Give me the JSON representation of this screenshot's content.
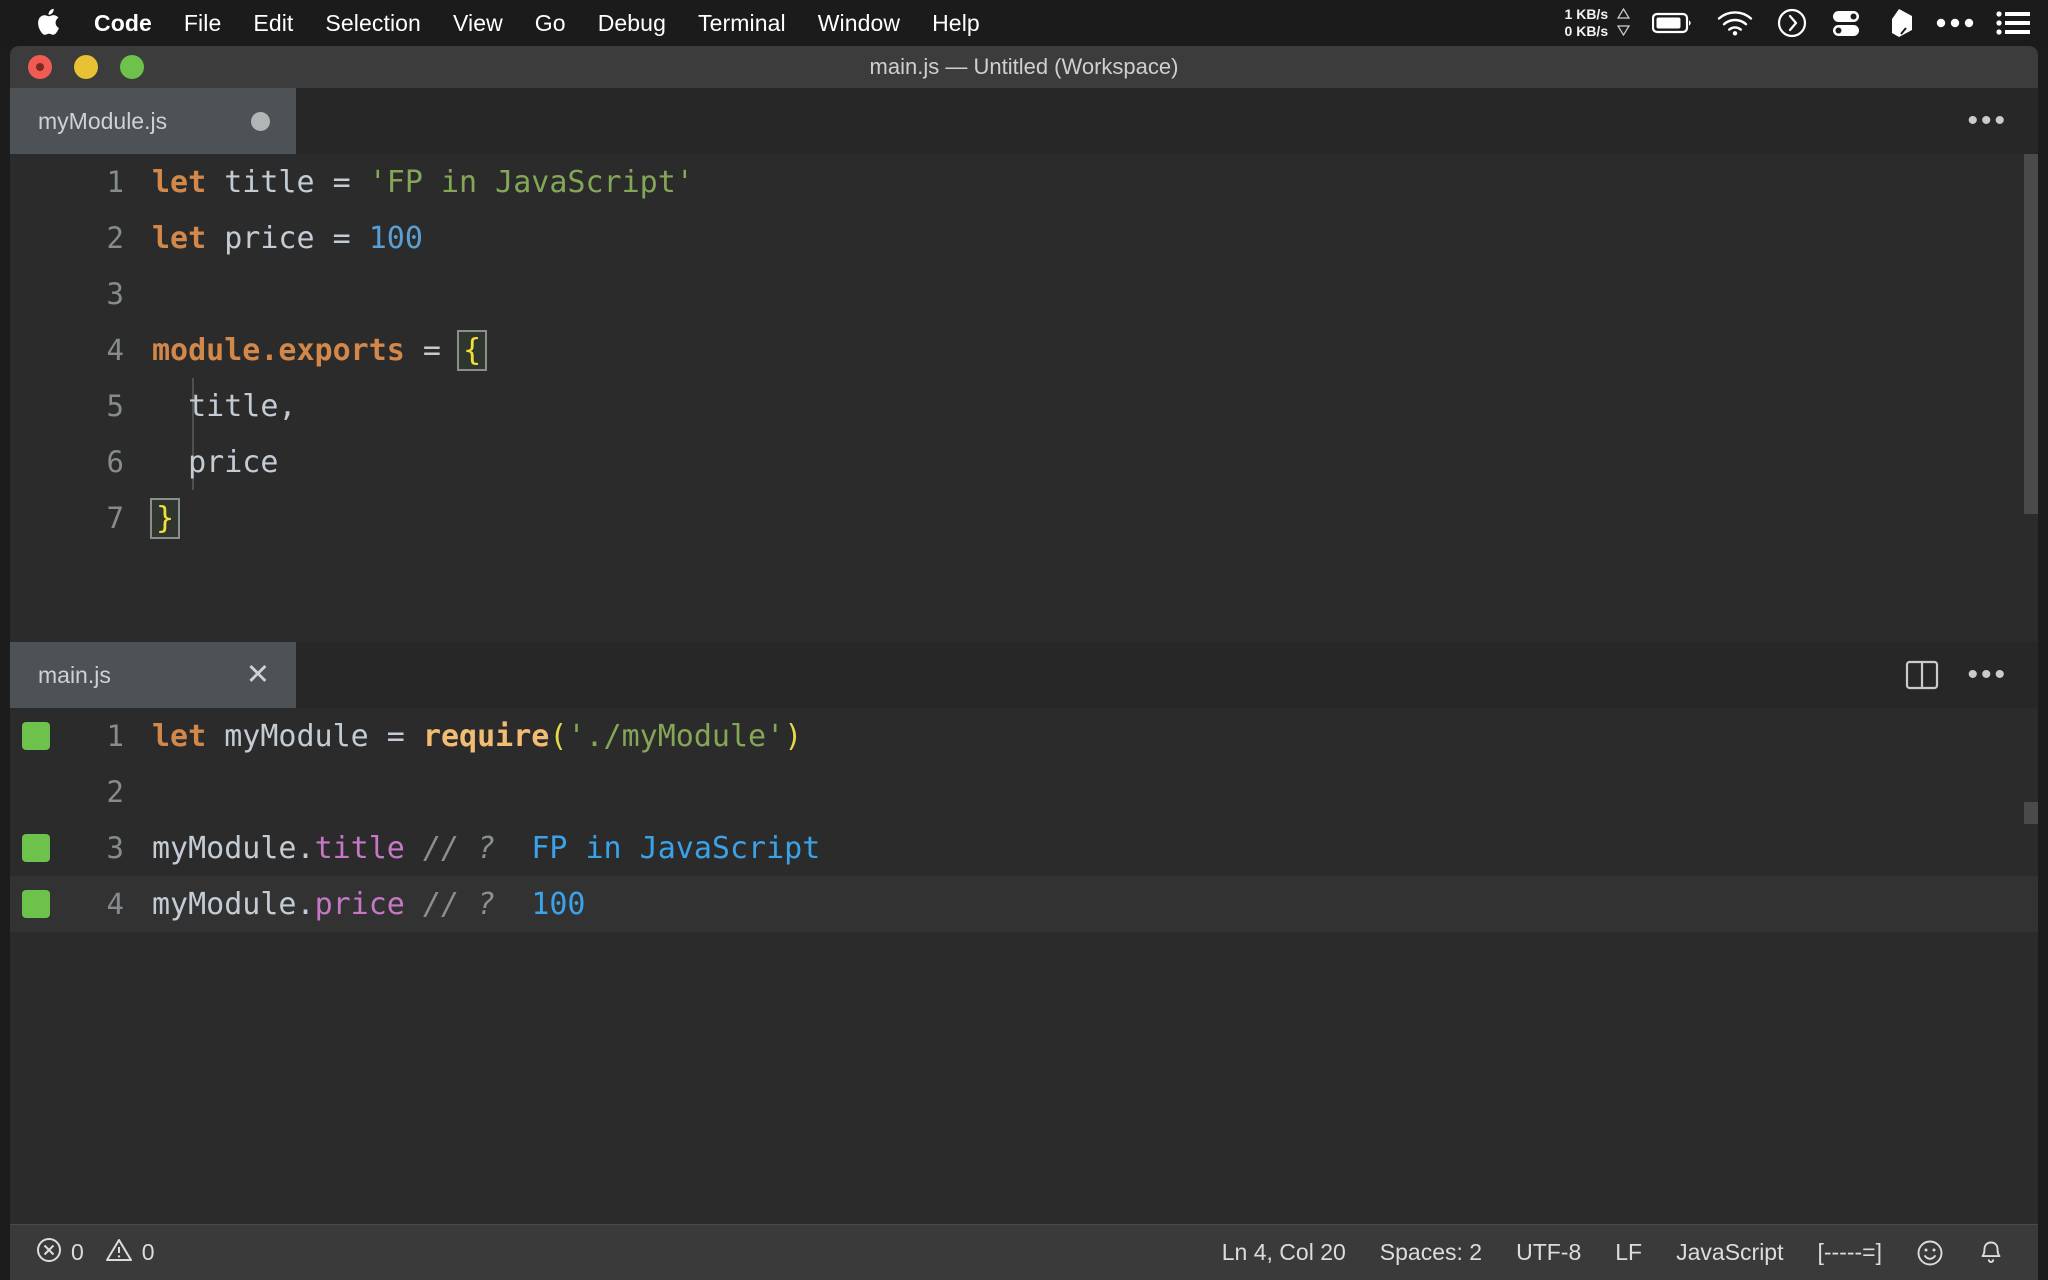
{
  "menubar": {
    "apple_icon": "apple-logo",
    "items": [
      {
        "label": "Code",
        "bold": true
      },
      {
        "label": "File",
        "bold": false
      },
      {
        "label": "Edit",
        "bold": false
      },
      {
        "label": "Selection",
        "bold": false
      },
      {
        "label": "View",
        "bold": false
      },
      {
        "label": "Go",
        "bold": false
      },
      {
        "label": "Debug",
        "bold": false
      },
      {
        "label": "Terminal",
        "bold": false
      },
      {
        "label": "Window",
        "bold": false
      },
      {
        "label": "Help",
        "bold": false
      }
    ],
    "network": {
      "upload": "1 KB/s",
      "download": "0 KB/s"
    },
    "status_icons": [
      "battery-icon",
      "wifi-icon",
      "clock-icon",
      "sliders-icon",
      "dropbox-icon",
      "ellipsis-icon",
      "list-icon"
    ]
  },
  "window": {
    "title": "main.js — Untitled (Workspace)",
    "traffic_lights": [
      "close-button",
      "minimize-button",
      "maximize-button"
    ]
  },
  "editor_top": {
    "tab": {
      "label": "myModule.js",
      "dirty": true,
      "dirty_indicator": "unsaved-dot"
    },
    "actions": [
      "more-actions-icon"
    ],
    "lines": [
      {
        "number": "1",
        "tokens": [
          {
            "text": "let",
            "cls": "t-kw"
          },
          {
            "text": " ",
            "cls": "t-op"
          },
          {
            "text": "title",
            "cls": "t-var"
          },
          {
            "text": " = ",
            "cls": "t-op"
          },
          {
            "text": "'FP in JavaScript'",
            "cls": "t-str"
          }
        ]
      },
      {
        "number": "2",
        "tokens": [
          {
            "text": "let",
            "cls": "t-kw"
          },
          {
            "text": " ",
            "cls": "t-op"
          },
          {
            "text": "price",
            "cls": "t-var"
          },
          {
            "text": " = ",
            "cls": "t-op"
          },
          {
            "text": "100",
            "cls": "t-num"
          }
        ]
      },
      {
        "number": "3",
        "tokens": []
      },
      {
        "number": "4",
        "tokens": [
          {
            "text": "module.exports",
            "cls": "t-mod"
          },
          {
            "text": " = ",
            "cls": "t-op"
          },
          {
            "text": "{",
            "cls": "t-brace"
          }
        ]
      },
      {
        "number": "5",
        "tokens": [
          {
            "text": "  title,",
            "cls": "t-var"
          }
        ]
      },
      {
        "number": "6",
        "tokens": [
          {
            "text": "  price",
            "cls": "t-var"
          }
        ]
      },
      {
        "number": "7",
        "tokens": [
          {
            "text": "}",
            "cls": "t-brace"
          }
        ]
      }
    ]
  },
  "editor_bottom": {
    "tab": {
      "label": "main.js",
      "close_label": "✕"
    },
    "actions": [
      "split-editor-icon",
      "more-actions-icon"
    ],
    "lines": [
      {
        "number": "1",
        "marker": true,
        "current": false,
        "tokens": [
          {
            "text": "let",
            "cls": "t-kw"
          },
          {
            "text": " ",
            "cls": "t-op"
          },
          {
            "text": "myModule",
            "cls": "t-var"
          },
          {
            "text": " = ",
            "cls": "t-op"
          },
          {
            "text": "require",
            "cls": "t-fn"
          },
          {
            "text": "(",
            "cls": "t-paren"
          },
          {
            "text": "'./myModule'",
            "cls": "t-str"
          },
          {
            "text": ")",
            "cls": "t-paren"
          }
        ]
      },
      {
        "number": "2",
        "marker": false,
        "current": false,
        "tokens": []
      },
      {
        "number": "3",
        "marker": true,
        "current": false,
        "tokens": [
          {
            "text": "myModule",
            "cls": "t-var"
          },
          {
            "text": ".",
            "cls": "t-op"
          },
          {
            "text": "title",
            "cls": "t-prop"
          },
          {
            "text": " ",
            "cls": "t-op"
          },
          {
            "text": "// ?",
            "cls": "t-comment"
          },
          {
            "text": "  ",
            "cls": "t-op"
          },
          {
            "text": "FP in JavaScript",
            "cls": "t-value"
          }
        ]
      },
      {
        "number": "4",
        "marker": true,
        "current": true,
        "tokens": [
          {
            "text": "myModule",
            "cls": "t-var"
          },
          {
            "text": ".",
            "cls": "t-op"
          },
          {
            "text": "price",
            "cls": "t-prop"
          },
          {
            "text": " ",
            "cls": "t-op"
          },
          {
            "text": "// ?",
            "cls": "t-comment"
          },
          {
            "text": "  ",
            "cls": "t-op"
          },
          {
            "text": "100",
            "cls": "t-value"
          }
        ]
      }
    ]
  },
  "statusbar": {
    "errors": "0",
    "warnings": "0",
    "cursor": "Ln 4, Col 20",
    "indent": "Spaces: 2",
    "encoding": "UTF-8",
    "eol": "LF",
    "language": "JavaScript",
    "quokka": "[-----=]",
    "feedback_icon": "smiley-icon",
    "bell_icon": "bell-icon"
  }
}
